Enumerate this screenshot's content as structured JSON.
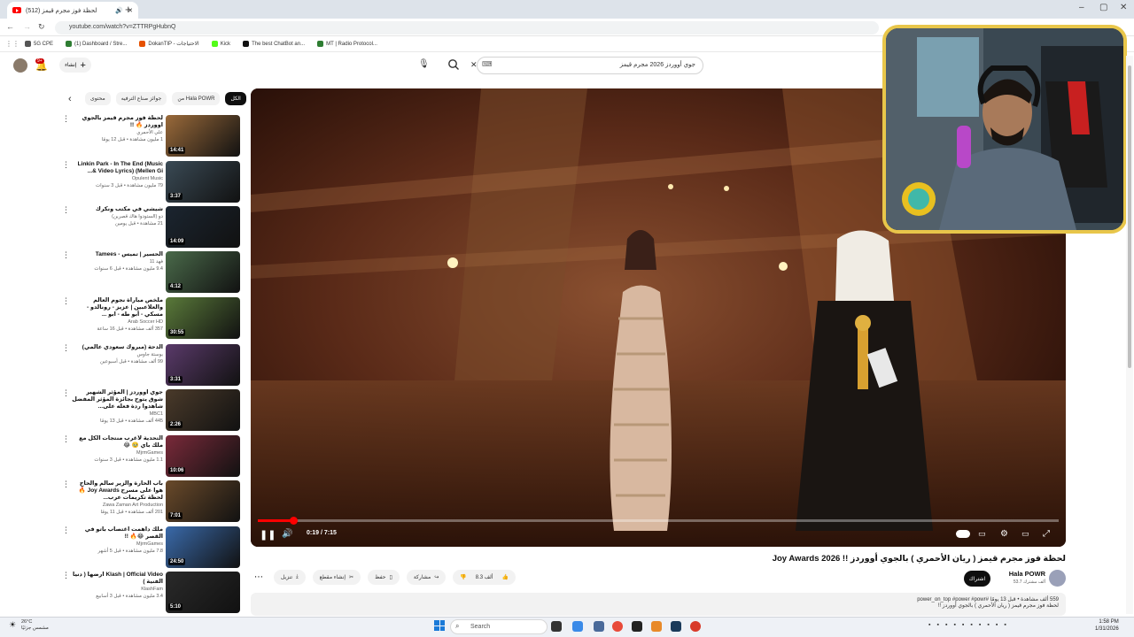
{
  "browser": {
    "tab_title": "(512) لحظة فوز مجرم قيمز",
    "new_tab": "+",
    "url": "youtube.com/watch?v=ZTTRPgHubnQ",
    "window_controls": [
      "–",
      "▢",
      "✕"
    ],
    "bookmarks": [
      {
        "label": "5G CPE",
        "color": "#555555"
      },
      {
        "label": "(1) Dashboard / Stre...",
        "color": "#2e7d32"
      },
      {
        "label": "DokanTIP - الاحتياجات",
        "color": "#e65100"
      },
      {
        "label": "Kick",
        "color": "#53fc18"
      },
      {
        "label": "The best ChatBot an...",
        "color": "#111111"
      },
      {
        "label": "MT | Radio Protocol...",
        "color": "#2e7d32"
      }
    ]
  },
  "youtube_header": {
    "create_label": "إنشاء",
    "notifications_count": "9+",
    "search_value": "جوي أووردز 2026 مجرم قيمز"
  },
  "chips": [
    "محتوى",
    "جوائز صناع الترفيه",
    "من Hala POWR",
    "الكل"
  ],
  "recommendations": [
    {
      "title": "لحظة فوز مجرم قيمز بالجوي اووردز 🔥 !!",
      "channel": "علي الأحمري",
      "meta": "1 مليون مشاهدة • قبل 12 يومًا",
      "duration": "14:41",
      "thumb": "#9a6a3a"
    },
    {
      "title": "Linkin Park - In The End (Music Video Lyrics) (Mellen Gi &...",
      "channel": "Opulent Music",
      "meta": "79 مليون مشاهدة • قبل 3 سنوات",
      "duration": "3:37",
      "thumb": "#3a4a55"
    },
    {
      "title": "شيشي في مكتب ونكرك",
      "channel": "دو (الستودوا هاك قصرين)",
      "meta": "21 مشاهدة • قبل يومين",
      "duration": "14:09",
      "thumb": "#1b2530"
    },
    {
      "title": "الحسير | تميس - Tamees",
      "channel": "فهد 11",
      "meta": "9.4 مليون مشاهدة • قبل 6 سنوات",
      "duration": "4:12",
      "thumb": "#4a6a4a"
    },
    {
      "title": "ملخص مباراة نجوم العالم والعلاعبين | عزيز - رونالدو - مسكي - أبو طه - ابو ...",
      "channel": "Arab Soccer HD",
      "meta": "357 ألف مشاهدة • قبل 16 ساعة",
      "duration": "30:55",
      "thumb": "#5a7a3a"
    },
    {
      "title": "الدحة (مبروك سعودي عالمي)",
      "channel": "بوستة جاوس",
      "meta": "99 ألف مشاهدة • قبل أسبوعين",
      "duration": "3:31",
      "thumb": "#5a3a6a"
    },
    {
      "title": "جوي أووردز | المؤثر الشهير شوق يتوج بجائزة المؤثر المفضل شاهدوا ردة فعله على...",
      "channel": "MBC1",
      "meta": "445 ألف مشاهدة • قبل 13 يومًا",
      "duration": "2:26",
      "thumb": "#4a3a2a"
    },
    {
      "title": "التحدية لأغرب منتجات الكل مع ملك باي 🥹 😂",
      "channel": "MjrmGames",
      "meta": "1.1 مليون مشاهدة • قبل 3 سنوات",
      "duration": "10:06",
      "thumb": "#7a2a3a"
    },
    {
      "title": "باب الحارة والزير سالم والحاج هوا على مسرح Joy Awards 🔥 لحظة تكريمات عرب...",
      "channel": "Zawa Zaman Art Production",
      "meta": "201 ألف مشاهدة • قبل 11 يومًا",
      "duration": "7:01",
      "thumb": "#6a4a2a"
    },
    {
      "title": "ملك داهمت اغتصاب باتو في القصر 😂🔥 !!",
      "channel": "MjrmGames",
      "meta": "7.8 مليون مشاهدة • قبل 5 أشهر",
      "duration": "24:50",
      "thumb": "#3a6aaa"
    },
    {
      "title": "Klash | Official Video أرضها ( دنيا الفنية )",
      "channel": "KlashFam",
      "meta": "3.4 مليون مشاهدة • قبل 3 أسابيع",
      "duration": "5:10",
      "thumb": "#2a2a2a"
    }
  ],
  "player": {
    "time": "0:19 / 7:15",
    "progress_fraction": 0.044
  },
  "video": {
    "title": "لحظة فوز مجرم قيمز ( ريان الأحمري ) بالجوي أووردز !! Joy Awards 2026",
    "channel": "Hala POWR",
    "subscribers": "53.7 ألف مشترك",
    "subscribe_label": "اشتراك",
    "likes": "8.3 ألف",
    "share_label": "مشاركة",
    "save_label": "حفظ",
    "clip_label": "إنشاء مقطع",
    "download_label": "تنزيل",
    "description_meta": "559 ألف مشاهدة • قبل 13 يومًا #power_on_top #power #powr",
    "description_text": "لحظة فوز مجرم قيمز ( ريان الأحمري ) بالجوي أووردز !!"
  },
  "taskbar": {
    "weather_temp": "26°C",
    "weather_desc": "مشمس جزئيًا",
    "search_label": "Search",
    "time": "1:58 PM",
    "date": "1/31/2026"
  }
}
